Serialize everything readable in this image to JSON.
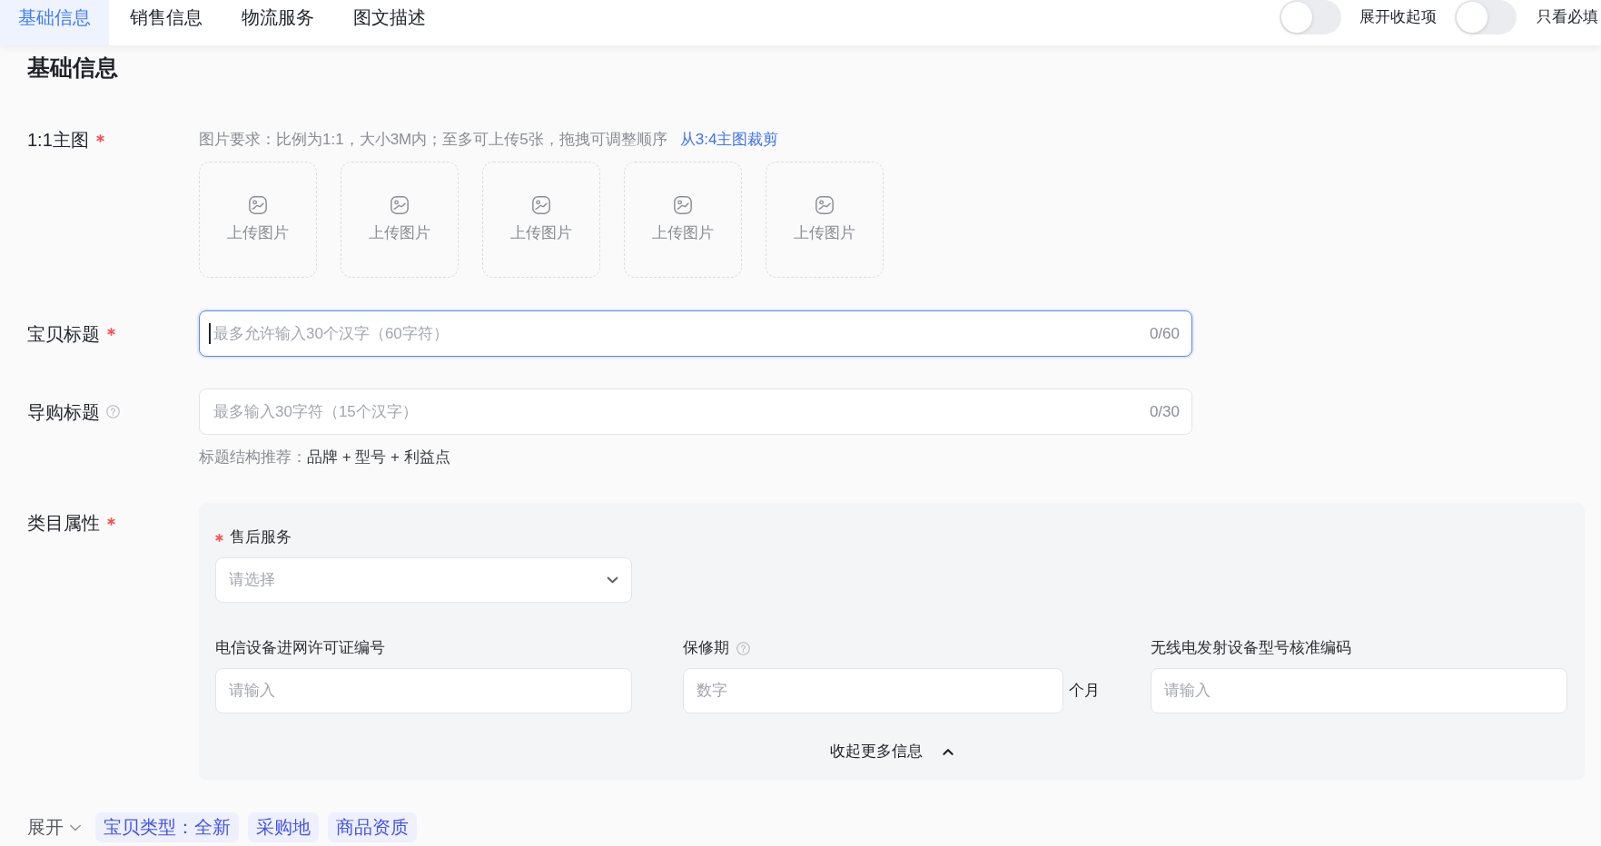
{
  "tabs": [
    {
      "label": "基础信息",
      "selected": true
    },
    {
      "label": "销售信息",
      "selected": false
    },
    {
      "label": "物流服务",
      "selected": false
    },
    {
      "label": "图文描述",
      "selected": false
    }
  ],
  "toggles": [
    {
      "label": "展开收起项",
      "on": false
    },
    {
      "label": "只看必填",
      "on": false
    }
  ],
  "section_title": "基础信息",
  "fields": [
    {
      "kind": "upload",
      "label": "1:1主图",
      "required": true,
      "help": false,
      "hint": "图片要求：比例为1:1，大小3M内；至多可上传5张，拖拽可调整顺序",
      "link": "从3:4主图裁剪",
      "slots": [
        "上传图片",
        "上传图片",
        "上传图片",
        "上传图片",
        "上传图片"
      ]
    },
    {
      "kind": "text",
      "label": "宝贝标题",
      "required": true,
      "help": false,
      "placeholder": "最多允许输入30个汉字（60字符）",
      "counter": "0/60",
      "focused": true
    },
    {
      "kind": "text",
      "label": "导购标题",
      "required": false,
      "help": true,
      "placeholder": "最多输入30字符（15个汉字）",
      "counter": "0/30",
      "focused": false,
      "tip_label": "标题结构推荐：",
      "tip_value": "品牌 + 型号 + 利益点"
    },
    {
      "kind": "attributes",
      "label": "类目属性",
      "required": true,
      "help": false,
      "items": [
        {
          "kind": "select",
          "label": "售后服务",
          "required": true,
          "help": false,
          "placeholder": "请选择"
        },
        {
          "kind": "input",
          "label": "电信设备进网许可证编号",
          "required": false,
          "help": false,
          "placeholder": "请输入"
        },
        {
          "kind": "input",
          "label": "保修期",
          "required": false,
          "help": true,
          "placeholder": "数字",
          "suffix": "个月"
        },
        {
          "kind": "input",
          "label": "无线电发射设备型号核准编码",
          "required": false,
          "help": false,
          "placeholder": "请输入"
        }
      ],
      "collapse": {
        "label": "收起更多信息",
        "expanded": true
      }
    }
  ],
  "more": {
    "label": "展开",
    "expanded": false
  },
  "tags": [
    "宝贝类型：全新",
    "采购地",
    "商品资质"
  ]
}
